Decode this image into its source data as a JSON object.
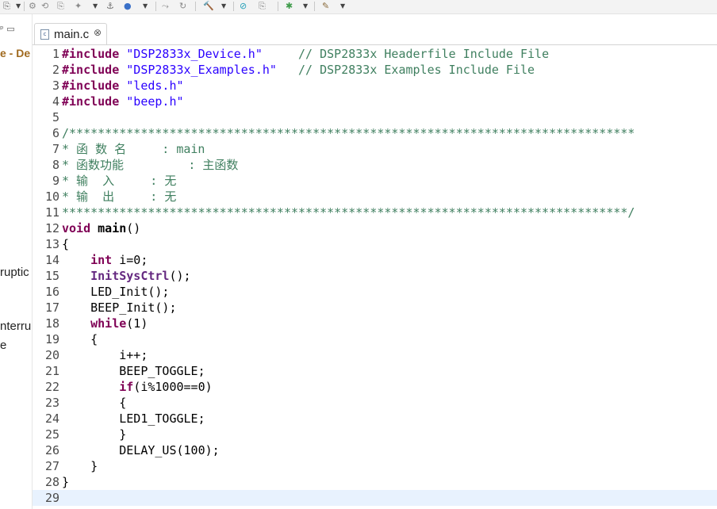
{
  "tab": {
    "filename": "main.c",
    "close": "⊗"
  },
  "left_panel": {
    "icons": "ᵖ  ▭",
    "title": "e - De",
    "snippets": [
      "ruptic",
      "nterru",
      "e"
    ]
  },
  "editor": {
    "lines": [
      [
        {
          "t": "pp",
          "v": "#include"
        },
        {
          "t": "n",
          "v": " "
        },
        {
          "t": "st",
          "v": "\"DSP2833x_Device.h\""
        },
        {
          "t": "n",
          "v": "     "
        },
        {
          "t": "cm",
          "v": "// DSP2833x Headerfile Include File"
        }
      ],
      [
        {
          "t": "pp",
          "v": "#include"
        },
        {
          "t": "n",
          "v": " "
        },
        {
          "t": "st",
          "v": "\"DSP2833x_Examples.h\""
        },
        {
          "t": "n",
          "v": "   "
        },
        {
          "t": "cm",
          "v": "// DSP2833x Examples Include File"
        }
      ],
      [
        {
          "t": "pp",
          "v": "#include"
        },
        {
          "t": "n",
          "v": " "
        },
        {
          "t": "st",
          "v": "\"leds.h\""
        }
      ],
      [
        {
          "t": "pp",
          "v": "#include"
        },
        {
          "t": "n",
          "v": " "
        },
        {
          "t": "st",
          "v": "\"beep.h\""
        }
      ],
      [],
      [
        {
          "t": "cm",
          "v": "/*******************************************************************************"
        }
      ],
      [
        {
          "t": "cm",
          "v": "* 函 数 名     : main"
        }
      ],
      [
        {
          "t": "cm",
          "v": "* 函数功能         : 主函数"
        }
      ],
      [
        {
          "t": "cm",
          "v": "* 输  入     : 无"
        }
      ],
      [
        {
          "t": "cm",
          "v": "* 输  出     : 无"
        }
      ],
      [
        {
          "t": "cm",
          "v": "*******************************************************************************/"
        }
      ],
      [
        {
          "t": "kw",
          "v": "void"
        },
        {
          "t": "n",
          "v": " "
        },
        {
          "t": "fn",
          "v": "main"
        },
        {
          "t": "n",
          "v": "()"
        }
      ],
      [
        {
          "t": "n",
          "v": "{"
        }
      ],
      [
        {
          "t": "n",
          "v": "    "
        },
        {
          "t": "kw",
          "v": "int"
        },
        {
          "t": "n",
          "v": " i=0;"
        }
      ],
      [
        {
          "t": "n",
          "v": "    "
        },
        {
          "t": "fnc",
          "v": "InitSysCtrl"
        },
        {
          "t": "n",
          "v": "();"
        }
      ],
      [
        {
          "t": "n",
          "v": "    LED_Init();"
        }
      ],
      [
        {
          "t": "n",
          "v": "    BEEP_Init();"
        }
      ],
      [
        {
          "t": "n",
          "v": "    "
        },
        {
          "t": "kw",
          "v": "while"
        },
        {
          "t": "n",
          "v": "(1)"
        }
      ],
      [
        {
          "t": "n",
          "v": "    {"
        }
      ],
      [
        {
          "t": "n",
          "v": "        i++;"
        }
      ],
      [
        {
          "t": "n",
          "v": "        BEEP_TOGGLE;"
        }
      ],
      [
        {
          "t": "n",
          "v": "        "
        },
        {
          "t": "kw",
          "v": "if"
        },
        {
          "t": "n",
          "v": "(i%1000==0)"
        }
      ],
      [
        {
          "t": "n",
          "v": "        {"
        }
      ],
      [
        {
          "t": "n",
          "v": "        LED1_TOGGLE;"
        }
      ],
      [
        {
          "t": "n",
          "v": "        }"
        }
      ],
      [
        {
          "t": "n",
          "v": "        DELAY_US(100);"
        }
      ],
      [
        {
          "t": "n",
          "v": "    }"
        }
      ],
      [
        {
          "t": "n",
          "v": "}"
        }
      ],
      []
    ],
    "current_line": 29
  },
  "colors": {
    "keyword": "#7f0055",
    "string": "#2a00ff",
    "comment": "#3f7f5f",
    "function_call": "#642880",
    "current_line_bg": "#e8f2fe"
  },
  "icons": [
    "debug-icon",
    "flash-icon",
    "build-icon",
    "run-icon",
    "external-tools-icon",
    "link-icon",
    "search-icon",
    "settings-icon",
    "wand-icon"
  ]
}
